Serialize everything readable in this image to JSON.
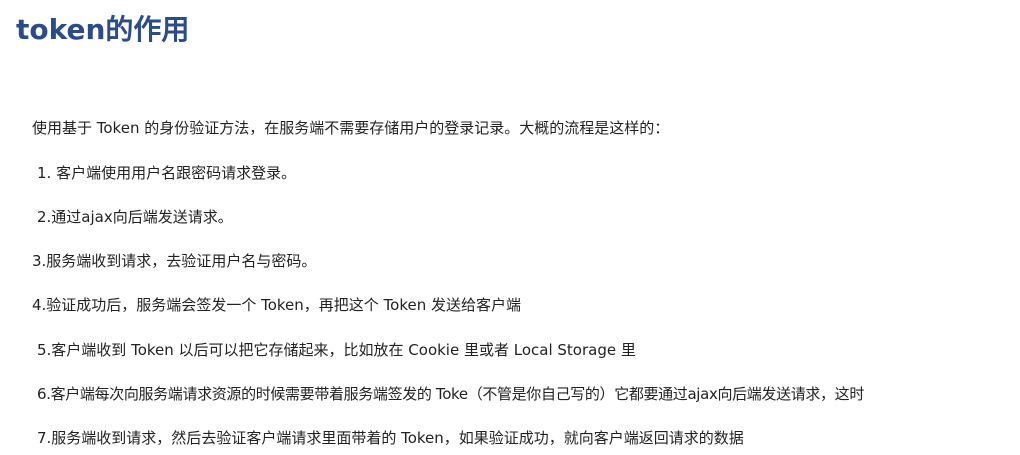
{
  "title": "token的作用",
  "intro": "使用基于 Token 的身份验证方法，在服务端不需要存储用户的登录记录。大概的流程是这样的：",
  "steps": [
    "1. 客户端使用用户名跟密码请求登录。",
    "2.通过ajax向后端发送请求。",
    "3.服务端收到请求，去验证用户名与密码。",
    "4.验证成功后，服务端会签发一个 Token，再把这个 Token 发送给客户端",
    "5.客户端收到 Token 以后可以把它存储起来，比如放在 Cookie 里或者 Local Storage 里",
    "6.客户端每次向服务端请求资源的时候需要带着服务端签发的 Toke（不管是你自己写的）它都要通过ajax向后端发送请求，这时",
    "7.服务端收到请求，然后去验证客户端请求里面带着的 Token，如果验证成功，就向客户端返回请求的数据"
  ],
  "colors": {
    "title": "#2b4c8c",
    "text": "#222222",
    "background": "#ffffff"
  }
}
